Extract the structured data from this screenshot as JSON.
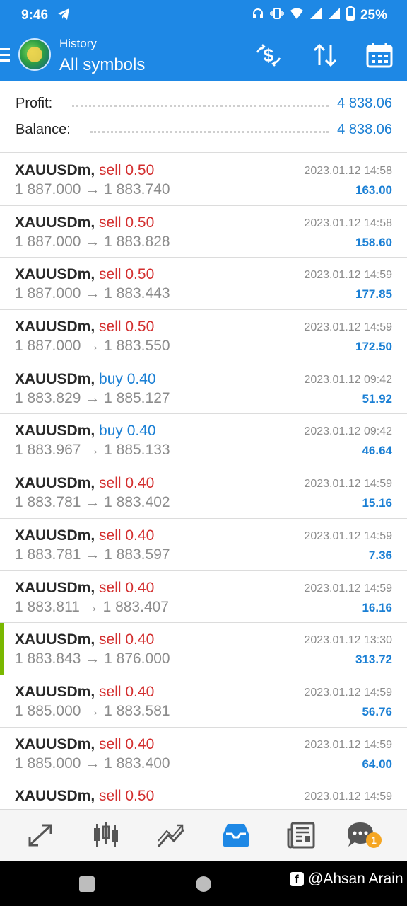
{
  "status_bar": {
    "time": "9:46",
    "battery": "25%"
  },
  "header": {
    "subtitle": "History",
    "title": "All symbols"
  },
  "summary": {
    "profit_label": "Profit:",
    "profit_value": "4 838.06",
    "balance_label": "Balance:",
    "balance_value": "4 838.06"
  },
  "trades": [
    {
      "symbol": "XAUUSDm,",
      "side": "sell 0.50",
      "type": "sell",
      "open": "1 887.000",
      "close": "1 883.740",
      "date": "2023.01.12 14:58",
      "profit": "163.00"
    },
    {
      "symbol": "XAUUSDm,",
      "side": "sell 0.50",
      "type": "sell",
      "open": "1 887.000",
      "close": "1 883.828",
      "date": "2023.01.12 14:58",
      "profit": "158.60"
    },
    {
      "symbol": "XAUUSDm,",
      "side": "sell 0.50",
      "type": "sell",
      "open": "1 887.000",
      "close": "1 883.443",
      "date": "2023.01.12 14:59",
      "profit": "177.85"
    },
    {
      "symbol": "XAUUSDm,",
      "side": "sell 0.50",
      "type": "sell",
      "open": "1 887.000",
      "close": "1 883.550",
      "date": "2023.01.12 14:59",
      "profit": "172.50"
    },
    {
      "symbol": "XAUUSDm,",
      "side": "buy 0.40",
      "type": "buy",
      "open": "1 883.829",
      "close": "1 885.127",
      "date": "2023.01.12 09:42",
      "profit": "51.92"
    },
    {
      "symbol": "XAUUSDm,",
      "side": "buy 0.40",
      "type": "buy",
      "open": "1 883.967",
      "close": "1 885.133",
      "date": "2023.01.12 09:42",
      "profit": "46.64"
    },
    {
      "symbol": "XAUUSDm,",
      "side": "sell 0.40",
      "type": "sell",
      "open": "1 883.781",
      "close": "1 883.402",
      "date": "2023.01.12 14:59",
      "profit": "15.16"
    },
    {
      "symbol": "XAUUSDm,",
      "side": "sell 0.40",
      "type": "sell",
      "open": "1 883.781",
      "close": "1 883.597",
      "date": "2023.01.12 14:59",
      "profit": "7.36"
    },
    {
      "symbol": "XAUUSDm,",
      "side": "sell 0.40",
      "type": "sell",
      "open": "1 883.811",
      "close": "1 883.407",
      "date": "2023.01.12 14:59",
      "profit": "16.16"
    },
    {
      "symbol": "XAUUSDm,",
      "side": "sell 0.40",
      "type": "sell",
      "open": "1 883.843",
      "close": "1 876.000",
      "date": "2023.01.12 13:30",
      "profit": "313.72",
      "highlight": true
    },
    {
      "symbol": "XAUUSDm,",
      "side": "sell 0.40",
      "type": "sell",
      "open": "1 885.000",
      "close": "1 883.581",
      "date": "2023.01.12 14:59",
      "profit": "56.76"
    },
    {
      "symbol": "XAUUSDm,",
      "side": "sell 0.40",
      "type": "sell",
      "open": "1 885.000",
      "close": "1 883.400",
      "date": "2023.01.12 14:59",
      "profit": "64.00"
    },
    {
      "symbol": "XAUUSDm,",
      "side": "sell 0.50",
      "type": "sell",
      "open": "",
      "close": "",
      "date": "2023.01.12 14:59",
      "profit": ""
    }
  ],
  "arrow": "→",
  "bottom_nav": {
    "chat_badge": "1"
  },
  "watermark": {
    "fb": "f",
    "text": "@Ahsan Arain"
  },
  "colors": {
    "accent": "#1e88e5",
    "sell": "#d32f2f",
    "buy": "#1a7fd4",
    "highlight": "#7ab800",
    "badge": "#f5a623"
  },
  "icons": [
    "telegram-icon",
    "headphones-icon",
    "vibrate-icon",
    "wifi-icon",
    "signal-icon",
    "battery-icon",
    "currency-exchange-icon",
    "sort-icon",
    "calendar-icon",
    "trade-icon",
    "quotes-icon",
    "chart-icon",
    "history-icon",
    "news-icon",
    "chat-icon"
  ]
}
